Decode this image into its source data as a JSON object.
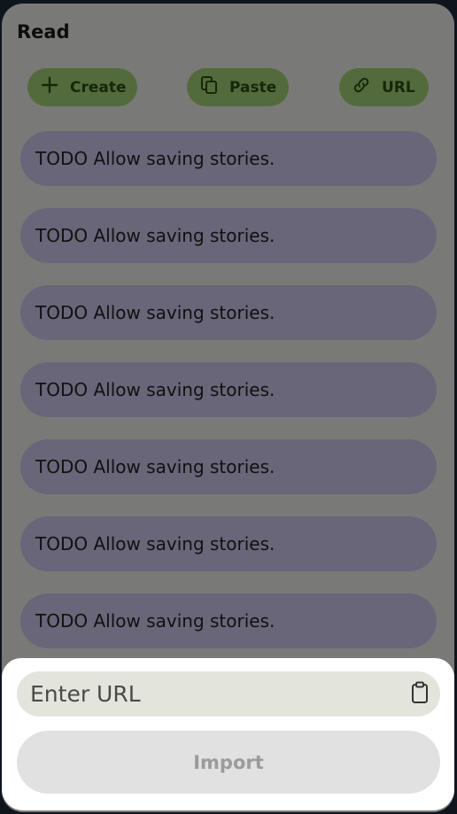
{
  "header": {
    "title": "Read"
  },
  "toolbar": {
    "create_label": "Create",
    "paste_label": "Paste",
    "url_label": "URL"
  },
  "stories": [
    {
      "text": "TODO Allow saving stories."
    },
    {
      "text": "TODO Allow saving stories."
    },
    {
      "text": "TODO Allow saving stories."
    },
    {
      "text": "TODO Allow saving stories."
    },
    {
      "text": "TODO Allow saving stories."
    },
    {
      "text": "TODO Allow saving stories."
    },
    {
      "text": "TODO Allow saving stories."
    }
  ],
  "sheet": {
    "url_placeholder": "Enter URL",
    "url_value": "",
    "import_label": "Import"
  },
  "colors": {
    "accent_button": "#a6d678",
    "story_card": "#d2cdf2",
    "scrim": "rgba(0,0,0,0.5)"
  },
  "icons": [
    "plus-icon",
    "paste-icon",
    "link-icon",
    "clipboard-icon"
  ]
}
